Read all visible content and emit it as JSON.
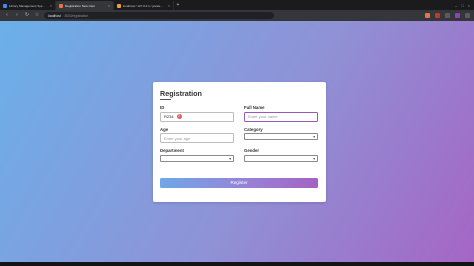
{
  "browser": {
    "tabs": [
      {
        "label": "Library Management System with G",
        "active": false,
        "color": "#4a86e8"
      },
      {
        "label": "Registration New User",
        "active": true,
        "color": "#e8734a"
      },
      {
        "label": "localhost / 127.0.0.1 / javaweb / stu",
        "active": false,
        "color": "#f0a030"
      }
    ],
    "url_host": "localhost",
    "url_path": ":3000/registration"
  },
  "form": {
    "title": "Registration",
    "id_label": "ID",
    "id_value": "R234",
    "id_badge": "2",
    "fullname_label": "Full Name",
    "fullname_placeholder": "Enter your name",
    "age_label": "Age",
    "age_placeholder": "Enter your age",
    "category_label": "Category",
    "department_label": "Department",
    "gender_label": "Gender",
    "register_label": "Register"
  },
  "colors": {
    "accent": "#9b59b6",
    "badge": "#e35a6a"
  }
}
